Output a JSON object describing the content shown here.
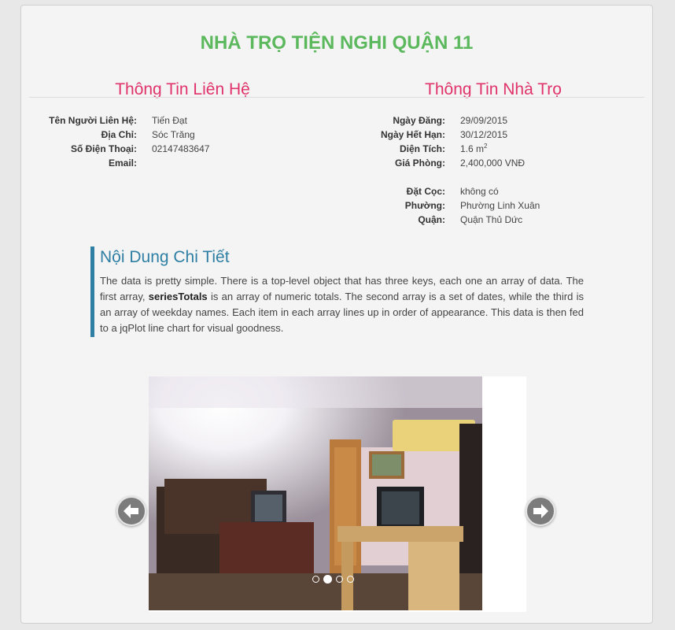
{
  "page": {
    "title": "NHÀ TRỌ TIỆN NGHI QUẬN 11"
  },
  "contact": {
    "heading": "Thông Tin Liên Hệ",
    "rows": [
      {
        "label": "Tên Người Liên Hệ:",
        "value": "Tiến Đạt"
      },
      {
        "label": "Địa Chỉ:",
        "value": "Sóc Trăng"
      },
      {
        "label": "Số Điện Thoại:",
        "value": "02147483647"
      },
      {
        "label": "Email:",
        "value": ""
      }
    ]
  },
  "room": {
    "heading": "Thông Tin Nhà Trọ",
    "rows_top": [
      {
        "label": "Ngày Đăng:",
        "value": "29/09/2015"
      },
      {
        "label": "Ngày Hết Hạn:",
        "value": "30/12/2015"
      },
      {
        "label": "Diện Tích:",
        "value": "1.6 m",
        "sup": "2"
      },
      {
        "label": "Giá Phòng:",
        "value": "2,400,000 VNĐ"
      }
    ],
    "rows_bottom": [
      {
        "label": "Đặt Cọc:",
        "value": "không có"
      },
      {
        "label": "Phường:",
        "value": "Phường Linh Xuân"
      },
      {
        "label": "Quận:",
        "value": "Quận Thủ Dức"
      }
    ]
  },
  "detail": {
    "heading": "Nội Dung Chi Tiết",
    "text_before": "The data is pretty simple. There is a top-level object that has three keys, each one an array of data. The first array, ",
    "text_bold": "seriesTotals",
    "text_after": " is an array of numeric totals. The second array is a set of dates, while the third is an array of weekday names. Each item in each array lines up in order of appearance. This data is then fed to a jqPlot line chart for visual goodness."
  },
  "slider": {
    "prev_icon": "arrow-left-icon",
    "next_icon": "arrow-right-icon",
    "slide_count": 4,
    "active_slide": 2,
    "colors": {
      "arrow": "#7c7c7c",
      "dot": "#ffffff"
    }
  },
  "colors": {
    "title": "#5cb85c",
    "heading": "#e0336b",
    "accent": "#2e7fa3"
  }
}
